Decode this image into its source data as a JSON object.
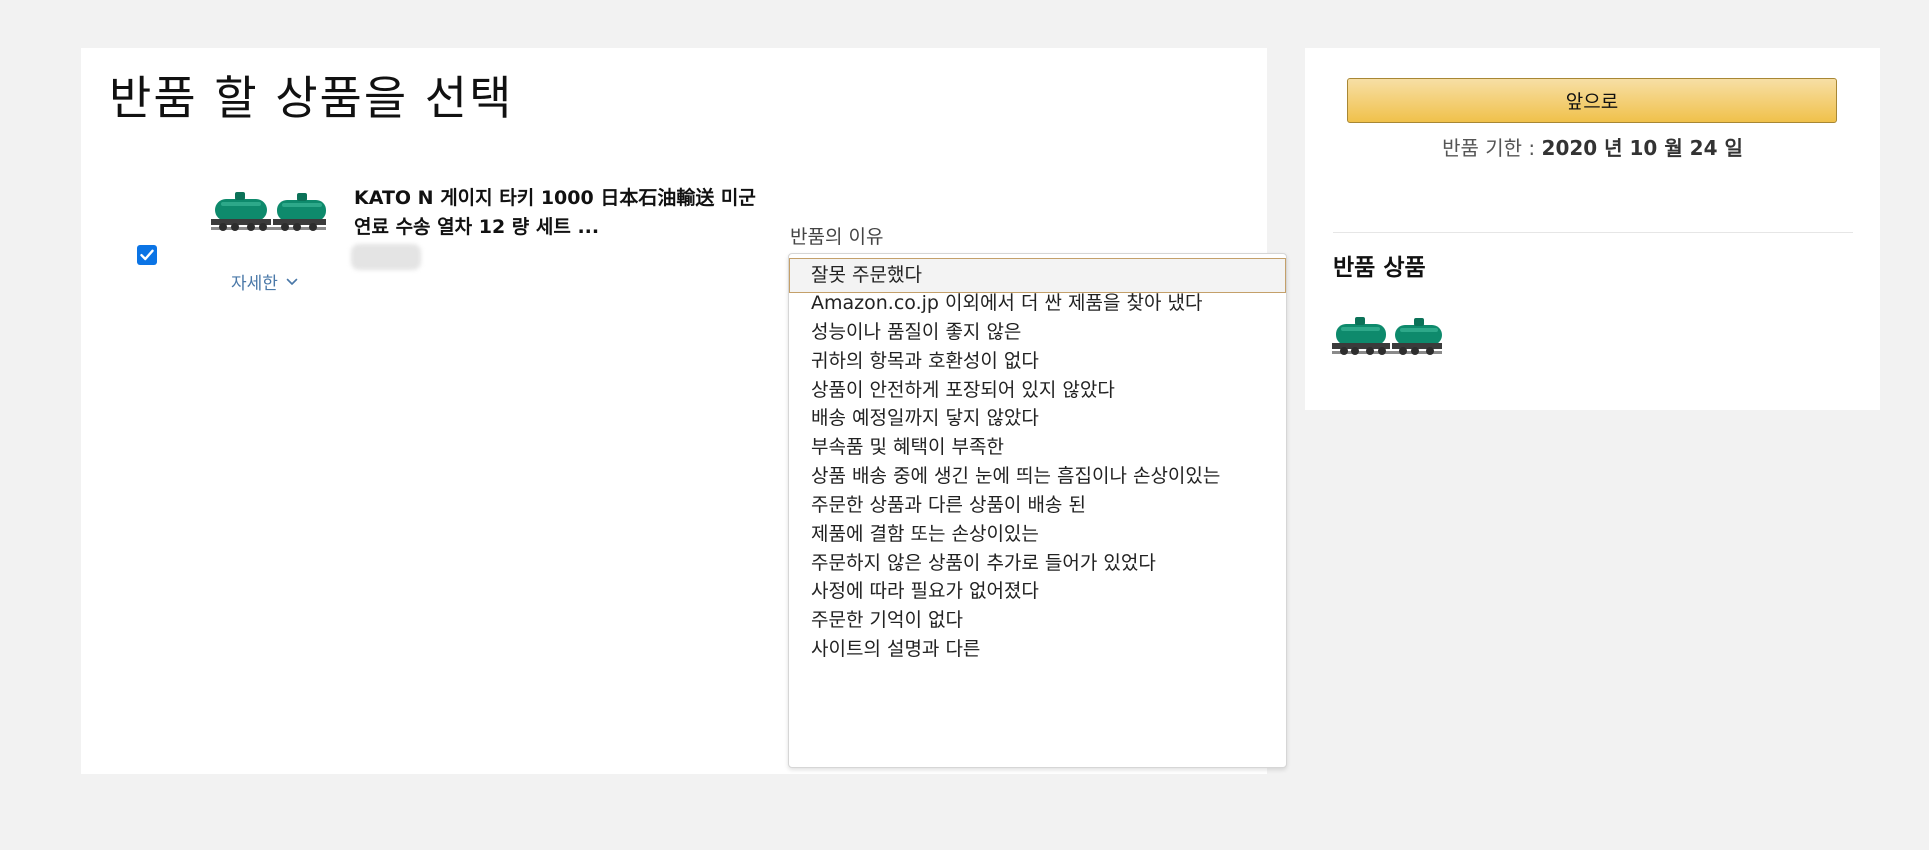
{
  "page_title": "반품 할 상품을 선택",
  "item": {
    "checked": true,
    "image_icon": "train-tank-car-image",
    "title": "KATO N 게이지 타키 1000 日本石油輸送 미군 연료 수송 열차 12 량 세트 ...",
    "details_label": "자세한",
    "details_icon": "chevron-down-icon"
  },
  "reason": {
    "label": "반품의 이유",
    "selected": "잘못 주문했다",
    "options": [
      "잘못 주문했다",
      "Amazon.co.jp 이외에서 더 싼 제품을 찾아 냈다",
      "성능이나 품질이 좋지 않은",
      "귀하의 항목과 호환성이 없다",
      "상품이 안전하게 포장되어 있지 않았다",
      "배송 예정일까지 닿지 않았다",
      "부속품 및 혜택이 부족한",
      "상품 배송 중에 생긴 눈에 띄는 흠집이나 손상이있는",
      "주문한 상품과 다른 상품이 배송 된",
      "제품에 결함 또는 손상이있는",
      "주문하지 않은 상품이 추가로 들어가 있었다",
      "사정에 따라 필요가 없어졌다",
      "주문한 기억이 없다",
      "사이트의 설명과 다른"
    ]
  },
  "sidebar": {
    "continue_label": "앞으로",
    "deadline_label": "반품 기한 : ",
    "deadline_date": "2020 년 10 월 24 일",
    "return_items_title": "반품 상품",
    "return_item_image_icon": "train-tank-car-image"
  },
  "colors": {
    "page_background": "#f2f2f2",
    "panel_background": "#ffffff",
    "button_gradient_top": "#f7dfa5",
    "button_gradient_bottom": "#f0c14b",
    "button_border": "#a88734",
    "checkbox": "#0b74e5",
    "link": "#4a78a8",
    "selected_option_border": "#c4a06a"
  }
}
